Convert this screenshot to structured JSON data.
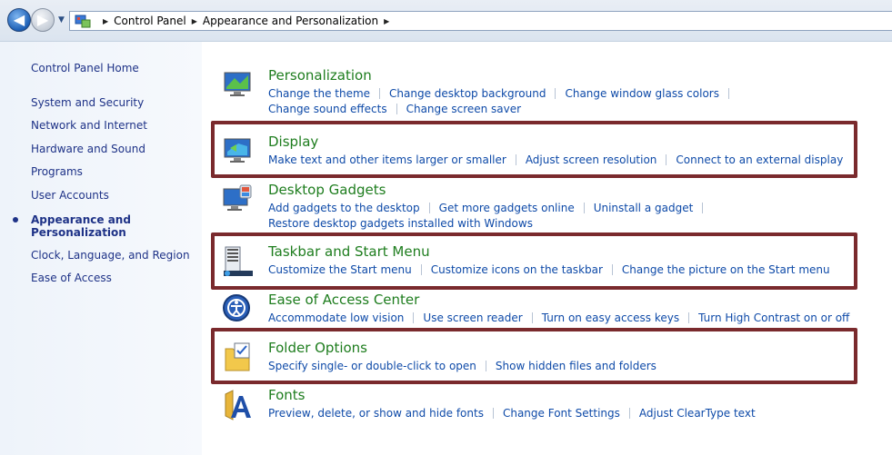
{
  "address": {
    "back_glyph": "◀",
    "forward_glyph": "▶",
    "dropdown_glyph": "▼",
    "separator_glyph": "▶",
    "breadcrumbs": [
      "Control Panel",
      "Appearance and Personalization"
    ]
  },
  "sidebar": {
    "home": "Control Panel Home",
    "items": [
      {
        "label": "System and Security"
      },
      {
        "label": "Network and Internet"
      },
      {
        "label": "Hardware and Sound"
      },
      {
        "label": "Programs"
      },
      {
        "label": "User Accounts"
      },
      {
        "label": "Appearance and Personalization",
        "line1": "Appearance and",
        "line2": "Personalization",
        "current": true
      },
      {
        "label": "Clock, Language, and Region"
      },
      {
        "label": "Ease of Access"
      }
    ]
  },
  "categories": [
    {
      "title": "Personalization",
      "icon": "personalization-icon",
      "links": [
        "Change the theme",
        "Change desktop background",
        "Change window glass colors",
        "Change sound effects",
        "Change screen saver"
      ]
    },
    {
      "title": "Display",
      "icon": "display-icon",
      "highlighted": true,
      "links": [
        "Make text and other items larger or smaller",
        "Adjust screen resolution",
        "Connect to an external display"
      ]
    },
    {
      "title": "Desktop Gadgets",
      "icon": "gadgets-icon",
      "links": [
        "Add gadgets to the desktop",
        "Get more gadgets online",
        "Uninstall a gadget",
        "Restore desktop gadgets installed with Windows"
      ]
    },
    {
      "title": "Taskbar and Start Menu",
      "icon": "taskbar-icon",
      "highlighted": true,
      "links": [
        "Customize the Start menu",
        "Customize icons on the taskbar",
        "Change the picture on the Start menu"
      ]
    },
    {
      "title": "Ease of Access Center",
      "icon": "ease-of-access-icon",
      "links": [
        "Accommodate low vision",
        "Use screen reader",
        "Turn on easy access keys",
        "Turn High Contrast on or off"
      ]
    },
    {
      "title": "Folder Options",
      "icon": "folder-options-icon",
      "highlighted": true,
      "links": [
        "Specify single- or double-click to open",
        "Show hidden files and folders"
      ]
    },
    {
      "title": "Fonts",
      "icon": "fonts-icon",
      "links": [
        "Preview, delete, or show and hide fonts",
        "Change Font Settings",
        "Adjust ClearType text"
      ]
    }
  ],
  "colors": {
    "highlight_border": "#7a2a2d",
    "title_green": "#1e7d1e",
    "link_blue": "#0e4aa8"
  }
}
